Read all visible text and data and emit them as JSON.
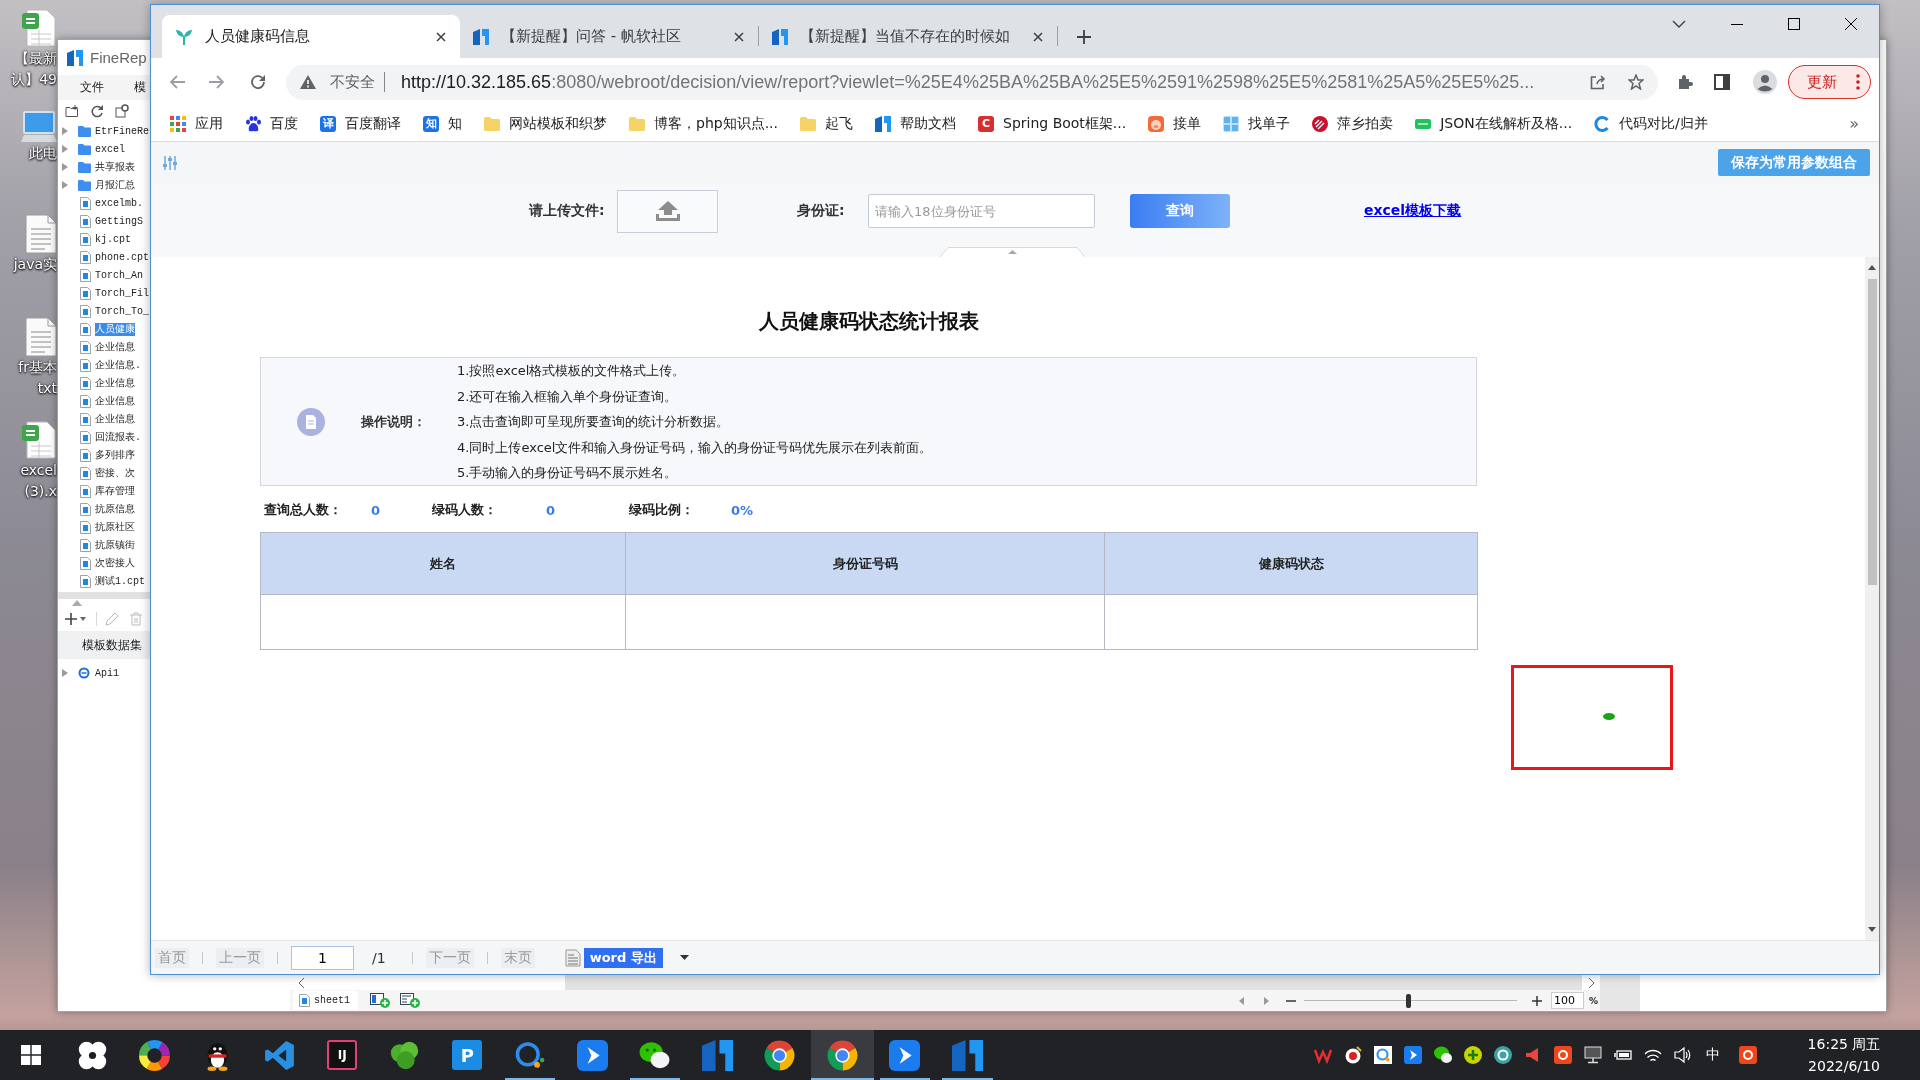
{
  "desktop": {
    "icons": [
      {
        "kind": "spreadsheet",
        "lines": [
          "【最新",
          "认】49"
        ]
      },
      {
        "kind": "computer",
        "lines": [
          "此电"
        ]
      },
      {
        "kind": "document",
        "lines": [
          "java实"
        ]
      },
      {
        "kind": "document",
        "lines": [
          "fr基本",
          "txt"
        ]
      },
      {
        "kind": "spreadsheet",
        "lines": [
          "excel",
          "(3).x"
        ]
      }
    ]
  },
  "designer": {
    "title": "FineRep",
    "menu": [
      "文件",
      "模"
    ],
    "tree": [
      {
        "kind": "folder",
        "label": "EtrFineRe",
        "selected": false
      },
      {
        "kind": "folder",
        "label": "excel",
        "selected": false
      },
      {
        "kind": "folder",
        "label": "共享报表",
        "selected": false
      },
      {
        "kind": "folder",
        "label": "月报汇总",
        "selected": false
      },
      {
        "kind": "file",
        "label": "excelmb.",
        "selected": false
      },
      {
        "kind": "file",
        "label": "GettingS",
        "selected": false
      },
      {
        "kind": "file",
        "label": "kj.cpt",
        "selected": false
      },
      {
        "kind": "file",
        "label": "phone.cpt",
        "selected": false
      },
      {
        "kind": "file",
        "label": "Torch_An",
        "selected": false
      },
      {
        "kind": "file",
        "label": "Torch_Fil",
        "selected": false
      },
      {
        "kind": "file",
        "label": "Torch_To_",
        "selected": false
      },
      {
        "kind": "file",
        "label": "人员健康",
        "selected": true
      },
      {
        "kind": "file",
        "label": "企业信息",
        "selected": false
      },
      {
        "kind": "file",
        "label": "企业信息.",
        "selected": false
      },
      {
        "kind": "file",
        "label": "企业信息",
        "selected": false
      },
      {
        "kind": "file",
        "label": "企业信息",
        "selected": false
      },
      {
        "kind": "file",
        "label": "企业信息",
        "selected": false
      },
      {
        "kind": "file",
        "label": "回流报表.",
        "selected": false
      },
      {
        "kind": "file",
        "label": "多列排序",
        "selected": false
      },
      {
        "kind": "file",
        "label": "密接、次",
        "selected": false
      },
      {
        "kind": "file",
        "label": "库存管理",
        "selected": false
      },
      {
        "kind": "file",
        "label": "抗原信息",
        "selected": false
      },
      {
        "kind": "file",
        "label": "抗原社区",
        "selected": false
      },
      {
        "kind": "file",
        "label": "抗原镇街",
        "selected": false
      },
      {
        "kind": "file",
        "label": "次密接人",
        "selected": false
      },
      {
        "kind": "file",
        "label": "测试1.cpt",
        "selected": false
      }
    ],
    "dataset_header": "模板数据集",
    "datasets": [
      {
        "label": "Api1"
      }
    ],
    "sheet_tab": "sheet1",
    "zoom": {
      "level": 0.49,
      "value": "100",
      "unit": "%"
    }
  },
  "browser": {
    "tabs": [
      {
        "kind": "health",
        "title": "人员健康码信息",
        "selected": true
      },
      {
        "kind": "logo",
        "title": "【新提醒】问答 - 帆软社区",
        "selected": false
      },
      {
        "kind": "logo",
        "title": "【新提醒】当值不存在的时候如",
        "selected": false
      }
    ],
    "security_label": "不安全",
    "url_host": "http://10.32.185.65",
    "url_path": ":8080/webroot/decision/view/report?viewlet=%25E4%25BA%25BA%25E5%2591%2598%25E5%2581%25A5%25E5%25...",
    "update_button": "更新",
    "bookmarks": [
      {
        "kind": "apps",
        "label": "应用"
      },
      {
        "kind": "paw",
        "label": "百度"
      },
      {
        "kind": "badge",
        "glyph": "译",
        "label": "百度翻译"
      },
      {
        "kind": "badge",
        "glyph": "知",
        "label": "知"
      },
      {
        "kind": "folder",
        "label": "网站模板和织梦"
      },
      {
        "kind": "folder",
        "label": "博客，php知识点..."
      },
      {
        "kind": "folder",
        "label": "起飞"
      },
      {
        "kind": "logo",
        "label": "帮助文档"
      },
      {
        "kind": "badge-red",
        "glyph": "C",
        "label": "Spring Boot框架..."
      },
      {
        "kind": "pig",
        "label": "接单"
      },
      {
        "kind": "grid",
        "label": "找单子"
      },
      {
        "kind": "stripes",
        "label": "萍乡拍卖"
      },
      {
        "kind": "tag",
        "label": "JSON在线解析及格..."
      },
      {
        "kind": "ring",
        "label": "代码对比/归并"
      }
    ],
    "more": "»"
  },
  "report": {
    "save_button": "保存为常用参数组合",
    "upload_label": "请上传文件:",
    "id_label": "身份证:",
    "id_field": {
      "placeholder": "请输入18位身份证号"
    },
    "query_button": "查询",
    "template_link": "excel模板下载",
    "title": "人员健康码状态统计报表",
    "instructions": {
      "label": "操作说明：",
      "lines": [
        "1.按照excel格式模板的文件格式上传。",
        "2.还可在输入框输入单个身份证查询。",
        "3.点击查询即可呈现所要查询的统计分析数据。",
        "4.同时上传excel文件和输入身份证号码，输入的身份证号码优先展示在列表前面。",
        "5.手动输入的身份证号码不展示姓名。"
      ]
    },
    "stats": [
      {
        "label": "查询总人数：",
        "value": "0"
      },
      {
        "label": "绿码人数：",
        "value": "0"
      },
      {
        "label": "绿码比例：",
        "value": "0%"
      }
    ],
    "table": {
      "columns": [
        "姓名",
        "身份证号码",
        "健康码状态"
      ]
    },
    "pager": {
      "before": [
        {
          "label": "首页",
          "disabled": true
        },
        {
          "label": "上一页",
          "disabled": true
        }
      ],
      "page": "1",
      "total": "/1",
      "after": [
        {
          "label": "下一页",
          "disabled": true
        },
        {
          "label": "末页",
          "disabled": true
        }
      ],
      "export": "word 导出"
    }
  },
  "taskbar": {
    "apps": [
      {
        "kind": "pinwheel",
        "running": false,
        "selected": false
      },
      {
        "kind": "color-wheel",
        "running": false,
        "selected": false
      },
      {
        "kind": "penguin",
        "running": false,
        "selected": false
      },
      {
        "kind": "code-editor",
        "running": false,
        "selected": false
      },
      {
        "kind": "tile",
        "glyph": "IJ",
        "running": false,
        "selected": false
      },
      {
        "kind": "leaf",
        "running": false,
        "selected": false
      },
      {
        "kind": "tile-blue",
        "glyph": "P",
        "running": false,
        "selected": false
      },
      {
        "kind": "chat-ring",
        "running": true,
        "selected": false
      },
      {
        "kind": "arrow-tile",
        "running": false,
        "selected": false
      },
      {
        "kind": "chat-bubbles",
        "running": true,
        "selected": false
      },
      {
        "kind": "logo",
        "running": false,
        "selected": false
      },
      {
        "kind": "browser-logo",
        "running": false,
        "selected": false
      },
      {
        "kind": "browser-logo",
        "running": true,
        "selected": true
      },
      {
        "kind": "arrow-tile",
        "running": true,
        "selected": false
      },
      {
        "kind": "logo",
        "running": true,
        "selected": false
      }
    ],
    "ime": "中",
    "time": "16:25 周五",
    "date": "2022/6/10"
  }
}
